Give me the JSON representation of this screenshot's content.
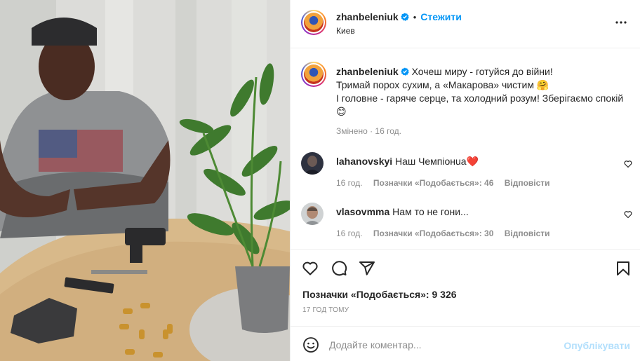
{
  "post": {
    "username": "zhanbeleniuk",
    "follow_label": "Стежити",
    "location": "Киев",
    "caption_lines": [
      "Хочеш миру - готуйся до війни!",
      "Тримай порох сухим, а «Макарова» чистим 🤗",
      "І головне - гаряче серце, та холодний розум! Зберігаємо спокій",
      "😊"
    ],
    "edited_label": "Змінено · 16 год."
  },
  "comments": [
    {
      "username": "lahanovskyi",
      "text": "Наш Чемпіонua❤️",
      "time": "16 год.",
      "likes_label": "Позначки «Подобається»: 46",
      "reply_label": "Відповісти"
    },
    {
      "username": "vlasovmma",
      "text": "Нам то не гони...",
      "time": "16 год.",
      "likes_label": "Позначки «Подобається»: 30",
      "reply_label": "Відповісти"
    }
  ],
  "actions": {
    "icons": [
      "heart-icon",
      "comment-icon",
      "share-icon",
      "bookmark-icon"
    ],
    "likes_label": "Позначки «Подобається»: 9 326",
    "time_ago": "17 ГОД ТОМУ"
  },
  "add_comment": {
    "placeholder": "Додайте коментар...",
    "publish_label": "Опублікувати"
  },
  "colors": {
    "link": "#0095f6",
    "publish_disabled": "#b2dffc",
    "meta": "#8e8e8e",
    "verified": "#0095f6"
  }
}
